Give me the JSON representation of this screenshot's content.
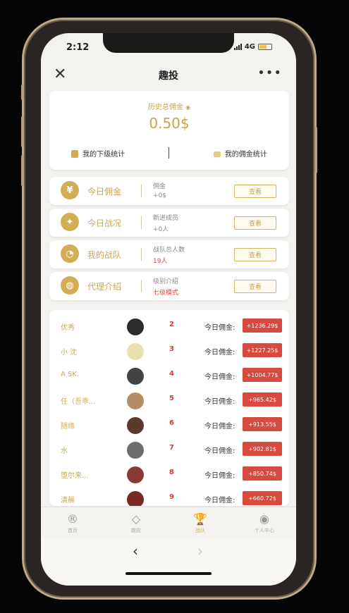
{
  "status": {
    "time": "2:12",
    "network": "4G"
  },
  "nav": {
    "close": "✕",
    "title": "趣投",
    "more": "•••"
  },
  "summary": {
    "label": "历史总佣金",
    "value": "0.50$",
    "link_left": "我的下级统计",
    "link_right": "我的佣金统计"
  },
  "features": [
    {
      "icon": "wallet-icon",
      "name": "今日佣金",
      "sub1": "佣金",
      "sub2": "+0$",
      "sub2_red": false,
      "button": "查看"
    },
    {
      "icon": "runner-icon",
      "name": "今日战况",
      "sub1": "新进成员",
      "sub2": "+0人",
      "sub2_red": false,
      "button": "查看"
    },
    {
      "icon": "pie-icon",
      "name": "我的战队",
      "sub1": "战队总人数",
      "sub2": "19人",
      "sub2_red": true,
      "button": "查看"
    },
    {
      "icon": "globe-icon",
      "name": "代理介绍",
      "sub1": "级别介绍",
      "sub2": "七级模式",
      "sub2_red": true,
      "button": "查看"
    }
  ],
  "ranking": [
    {
      "name": "优秀",
      "rank": "2",
      "label": "今日佣金:",
      "amount": "+1236.29$",
      "avatar": "#2d2d2d"
    },
    {
      "name": "小 沈",
      "rank": "3",
      "label": "今日佣金:",
      "amount": "+1227.25$",
      "avatar": "#e8e0b0"
    },
    {
      "name": "A SK.",
      "rank": "4",
      "label": "今日佣金:",
      "amount": "+1004.77$",
      "avatar": "#444444"
    },
    {
      "name": "任（吾乖...",
      "rank": "5",
      "label": "今日佣金:",
      "amount": "+965.42$",
      "avatar": "#b58d67"
    },
    {
      "name": "随缘",
      "rank": "6",
      "label": "今日佣金:",
      "amount": "+913.55$",
      "avatar": "#5a3a2c"
    },
    {
      "name": "水",
      "rank": "7",
      "label": "今日佣金:",
      "amount": "+902.81$",
      "avatar": "#6d6d6d"
    },
    {
      "name": "堕尔来...",
      "rank": "8",
      "label": "今日佣金:",
      "amount": "+850.74$",
      "avatar": "#8a3a36"
    },
    {
      "name": "清晨",
      "rank": "9",
      "label": "今日佣金:",
      "amount": "+660.72$",
      "avatar": "#7a2a25"
    }
  ],
  "tabs": [
    {
      "icon": "register-icon",
      "glyph": "®",
      "label": "首页",
      "active": false
    },
    {
      "icon": "diamond-icon",
      "glyph": "◇",
      "label": "趣投",
      "active": false
    },
    {
      "icon": "trophy-icon",
      "glyph": "🏆",
      "label": "战队",
      "active": true
    },
    {
      "icon": "user-icon",
      "glyph": "◉",
      "label": "个人中心",
      "active": false
    }
  ],
  "browser": {
    "back": "‹",
    "forward": "›"
  },
  "colors": {
    "gold": "#c7a54a",
    "red": "#d64a3f"
  }
}
